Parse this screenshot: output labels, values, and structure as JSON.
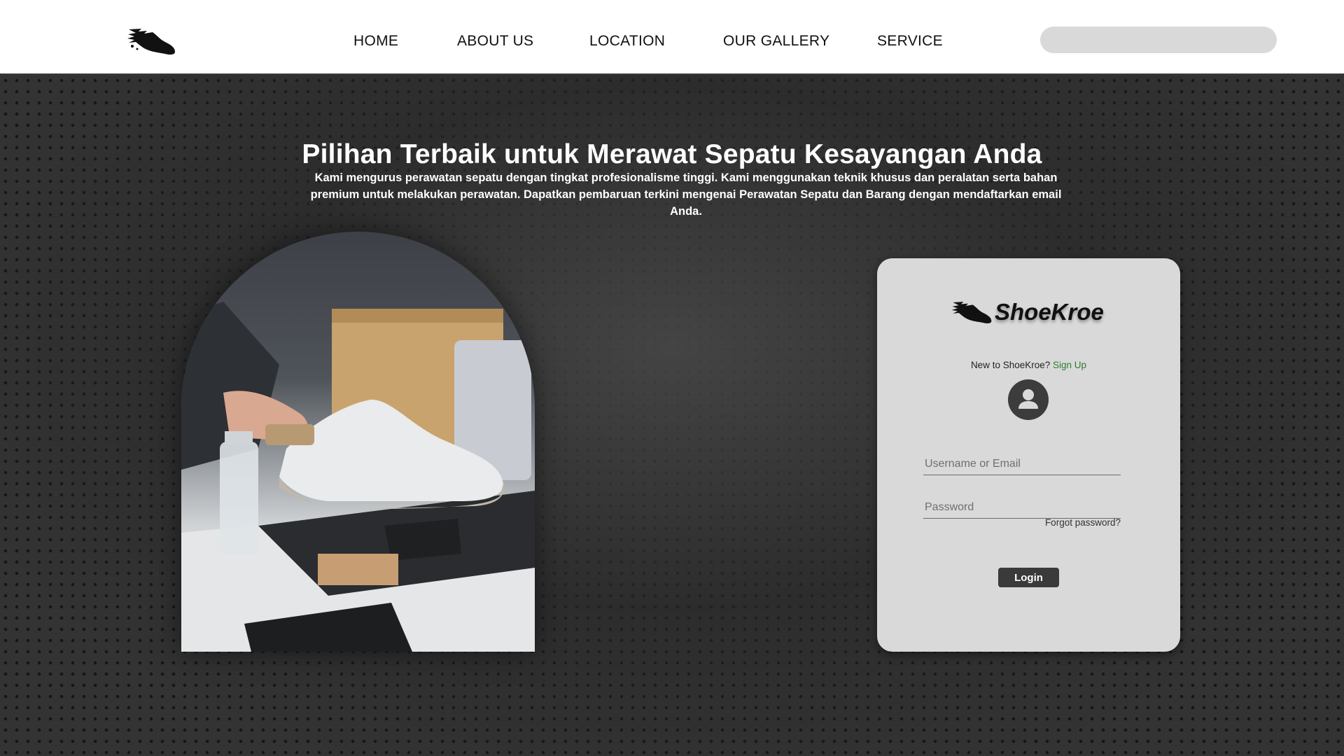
{
  "header": {
    "logo_icon": "running-shoe-splash-icon",
    "nav": [
      "HOME",
      "ABOUT US",
      "LOCATION",
      "OUR GALLERY",
      "SERVICE"
    ],
    "search_placeholder": ""
  },
  "hero": {
    "title": "Pilihan Terbaik untuk Merawat Sepatu Kesayangan Anda",
    "description": "Kami mengurus perawatan sepatu dengan tingkat profesionalisme tinggi. Kami menggunakan teknik khusus dan peralatan serta bahan premium untuk melakukan perawatan. Dapatkan pembaruan terkini mengenai Perawatan Sepatu dan Barang dengan mendaftarkan email Anda."
  },
  "login": {
    "brand": "ShoeKroe",
    "new_text": "New to ShoeKroe?",
    "signup_label": "Sign Up",
    "avatar_icon": "user-avatar-icon",
    "username_placeholder": "Username or Email",
    "password_placeholder": "Password",
    "forgot_label": "Forgot password?",
    "login_label": "Login"
  },
  "colors": {
    "header_bg": "#ffffff",
    "card_bg": "#d9d9d9",
    "button_bg": "#3a3a3a",
    "signup_link": "#2f7d2f"
  }
}
